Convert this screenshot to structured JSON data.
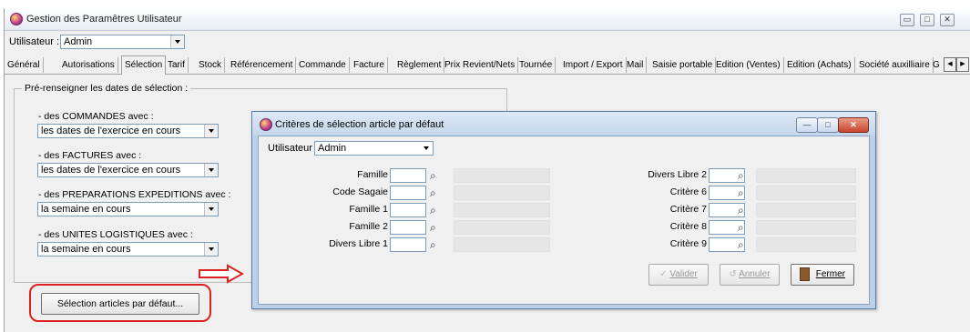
{
  "main_window": {
    "title": "Gestion des Paramêtres Utilisateur",
    "buttons": [
      "▭",
      "□",
      "✕"
    ],
    "user_label": "Utilisateur :",
    "user_value": "Admin"
  },
  "tabs": [
    "Général",
    "Autorisations",
    "Sélection",
    "Tarif",
    "Stock",
    "Référencement",
    "Commande",
    "Facture",
    "Règlement",
    "Prix Revient/Nets",
    "Tournée",
    "Import / Export",
    "Mail",
    "Saisie portable",
    "Edition (Ventes)",
    "Edition (Achats)",
    "Société auxilliaire",
    "G"
  ],
  "active_tab": "Sélection",
  "tab_scroll": [
    "◀",
    "▶"
  ],
  "group": {
    "title": "Pré-renseigner les dates de sélection :",
    "rows": [
      {
        "label": "- des COMMANDES avec :",
        "value": "les dates de l'exercice en cours"
      },
      {
        "label": "- des FACTURES avec :",
        "value": "les dates de l'exercice en cours"
      },
      {
        "label": "- des PREPARATIONS EXPEDITIONS avec :",
        "value": "la semaine en cours"
      },
      {
        "label": "- des UNITES LOGISTIQUES avec :",
        "value": "la semaine en cours"
      }
    ]
  },
  "selection_button": "Sélection articles par défaut...",
  "dialog": {
    "title": "Critères de sélection article par défaut",
    "buttons": [
      "—",
      "□",
      "✕"
    ],
    "user_label": "Utilisateur :",
    "user_value": "Admin",
    "left_fields": [
      "Famille",
      "Code Sagaie",
      "Famille 1",
      "Famille 2",
      "Divers Libre 1"
    ],
    "right_fields": [
      "Divers Libre 2",
      "Critère 6",
      "Critère 7",
      "Critère 8",
      "Critère 9"
    ],
    "field_icon": "search-icon",
    "btn_valider": "Valider",
    "btn_annuler": "Annuler",
    "btn_fermer": "Fermer"
  },
  "colors": {
    "highlight": "#e02020",
    "dialog_frame": "#bcd0e8",
    "window_bg": "#f0f0f0"
  }
}
